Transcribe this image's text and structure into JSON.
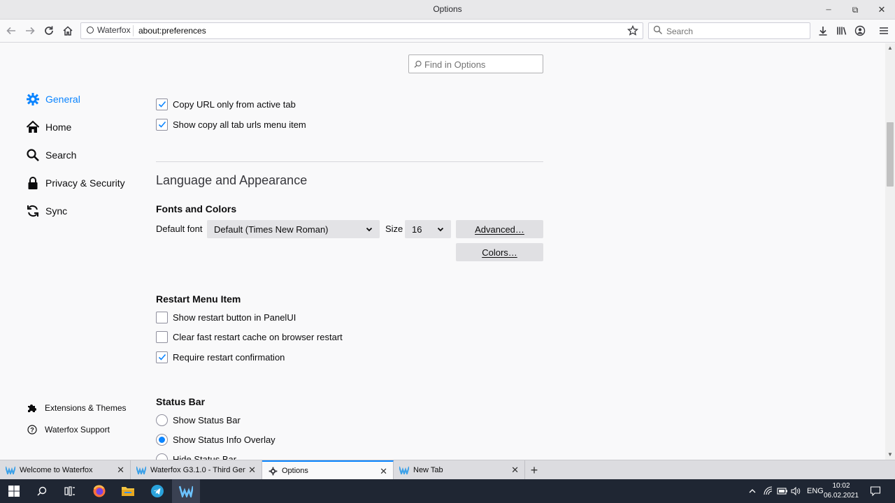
{
  "window": {
    "title": "Options",
    "minimize_label": "─",
    "maximize_label": "⧉",
    "close_label": "✕"
  },
  "navbar": {
    "identity_label": "Waterfox",
    "url": "about:preferences",
    "search_placeholder": "Search"
  },
  "preferences": {
    "find_placeholder": "Find in Options",
    "sidebar": {
      "items": [
        {
          "label": "General",
          "icon": "gear-icon",
          "active": true
        },
        {
          "label": "Home",
          "icon": "home-icon"
        },
        {
          "label": "Search",
          "icon": "search-icon"
        },
        {
          "label": "Privacy & Security",
          "icon": "lock-icon"
        },
        {
          "label": "Sync",
          "icon": "sync-icon"
        }
      ],
      "footer": [
        {
          "label": "Extensions & Themes",
          "icon": "puzzle-icon"
        },
        {
          "label": "Waterfox Support",
          "icon": "help-icon"
        }
      ]
    },
    "tabs_options": [
      {
        "label": "Copy URL only from active tab",
        "checked": true
      },
      {
        "label": "Show copy all tab urls menu item",
        "checked": true
      }
    ],
    "language_section": {
      "title": "Language and Appearance",
      "fonts_heading": "Fonts and Colors",
      "default_font_label": "Default font",
      "default_font_value": "Default (Times New Roman)",
      "size_label": "Size",
      "size_value": "16",
      "advanced_button": "Advanced…",
      "colors_button": "Colors…"
    },
    "restart_section": {
      "heading": "Restart Menu Item",
      "options": [
        {
          "label": "Show restart button in PanelUI",
          "checked": false
        },
        {
          "label": "Clear fast restart cache on browser restart",
          "checked": false
        },
        {
          "label": "Require restart confirmation",
          "checked": true
        }
      ]
    },
    "status_section": {
      "heading": "Status Bar",
      "options": [
        {
          "label": "Show Status Bar",
          "selected": false
        },
        {
          "label": "Show Status Info Overlay",
          "selected": true
        },
        {
          "label": "Hide Status Bar",
          "selected": false
        }
      ]
    }
  },
  "tabs": [
    {
      "label": "Welcome to Waterfox",
      "icon": "waterfox-icon"
    },
    {
      "label": "Waterfox G3.1.0 - Third Genera",
      "icon": "waterfox-icon"
    },
    {
      "label": "Options",
      "icon": "gear-icon",
      "active": true
    },
    {
      "label": "New Tab",
      "icon": "waterfox-icon"
    }
  ],
  "taskbar": {
    "language": "ENG",
    "time": "10:02",
    "date": "06.02.2021"
  },
  "colors": {
    "accent": "#0a84ff",
    "taskbar": "#1f2633"
  }
}
